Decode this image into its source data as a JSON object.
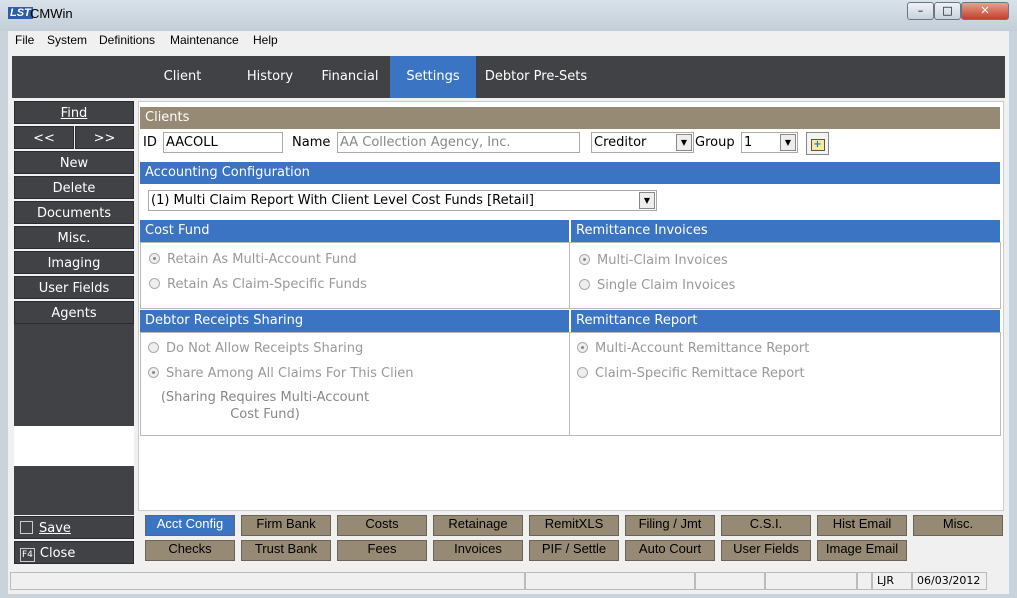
{
  "window": {
    "logo": "LST",
    "title": "CMWin",
    "controls": [
      "–",
      "□",
      "✕"
    ]
  },
  "menu": [
    "File",
    "System",
    "Definitions",
    "Maintenance",
    "Help"
  ],
  "tabs": [
    "Client",
    "History",
    "Financial",
    "Settings",
    "Debtor Pre-Sets"
  ],
  "sidebar": {
    "find": "Find",
    "prev": "<<",
    "next": ">>",
    "items": [
      "New",
      "Delete",
      "Documents",
      "Misc.",
      "Imaging",
      "User Fields",
      "Agents"
    ],
    "save": "Save",
    "close": "Close",
    "close_key": "F4"
  },
  "clients": {
    "header": "Clients",
    "id_label": "ID",
    "id_value": "AACOLL",
    "name_label": "Name",
    "name_value": "AA Collection Agency, Inc.",
    "type_value": "Creditor",
    "group_label": "Group",
    "group_value": "1"
  },
  "accounting": {
    "header": "Accounting Configuration",
    "value": "(1) Multi Claim Report With Client Level Cost Funds [Retail]"
  },
  "cost_fund": {
    "header": "Cost Fund",
    "options": [
      "Retain As Multi-Account Fund",
      "Retain As Claim-Specific Funds"
    ],
    "selected": 0
  },
  "remit_invoices": {
    "header": "Remittance Invoices",
    "options": [
      "Multi-Claim Invoices",
      "Single Claim Invoices"
    ],
    "selected": 0
  },
  "receipts": {
    "header": "Debtor Receipts Sharing",
    "options": [
      "Do Not Allow Receipts Sharing",
      "Share Among All Claims For This Clien"
    ],
    "selected": 1,
    "note1": "(Sharing Requires Multi-Account",
    "note2": "Cost Fund)"
  },
  "remit_report": {
    "header": "Remittance Report",
    "options": [
      "Multi-Account Remittance Report",
      "Claim-Specific Remittace Report"
    ],
    "selected": 0
  },
  "buttons_row1": [
    "Acct Config",
    "Firm Bank",
    "Costs",
    "Retainage",
    "RemitXLS",
    "Filing / Jmt",
    "C.S.I.",
    "Hist Email",
    "Misc."
  ],
  "buttons_row2": [
    "Checks",
    "Trust Bank",
    "Fees",
    "Invoices",
    "PIF / Settle",
    "Auto Court",
    "User Fields",
    "Image Email"
  ],
  "status": {
    "user": "LJR",
    "date": "06/03/2012"
  },
  "colors": {
    "accent": "#3a74c2",
    "tan": "#968a74",
    "dark": "#404246"
  }
}
